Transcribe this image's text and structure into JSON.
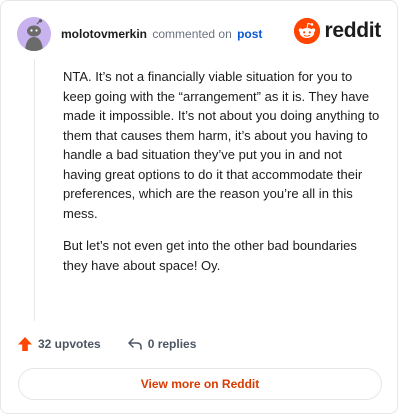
{
  "comment": {
    "username": "molotovmerkin",
    "action_text": "commented on",
    "link_text": "post",
    "paragraphs": [
      "NTA. It’s not a financially viable situation for you to keep going with the “arrangement” as it is. They have made it impossible. It’s not about you doing anything to them that causes them harm, it’s about you having to handle a bad situation they’ve put you in and not having great options to do it that accommodate their preferences, which are the reason you’re all in this mess.",
      "But let’s not even get into the other bad boundaries they have about space! Oy."
    ],
    "upvotes": "32 upvotes",
    "replies": "0 replies"
  },
  "brand": {
    "name": "reddit",
    "icon": "reddit-alien-icon",
    "accent_color": "#ff4500"
  },
  "footer": {
    "view_more_label": "View more on Reddit"
  },
  "colors": {
    "upvote_arrow": "#ff4500",
    "link": "#0b57d0",
    "view_more_text": "#d93a00",
    "avatar_bg": "#c9b3ee"
  }
}
